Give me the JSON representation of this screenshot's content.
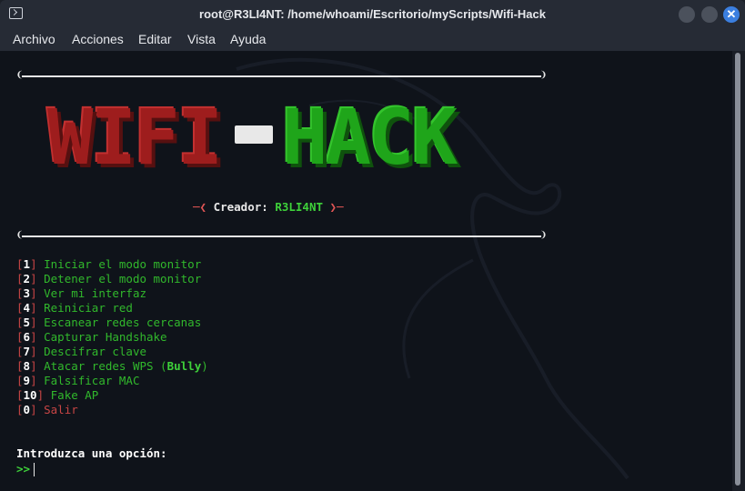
{
  "window": {
    "title": "root@R3LI4NT: /home/whoami/Escritorio/myScripts/Wifi-Hack",
    "close_glyph": "✕"
  },
  "menubar": [
    "Archivo",
    "Acciones",
    "Editar",
    "Vista",
    "Ayuda"
  ],
  "banner": {
    "logo_left": "WIFI",
    "logo_right": "HACK",
    "rule_left": "❨",
    "rule_right": "❩",
    "creator_prefix": "─❮ ",
    "creator_label": "Creador: ",
    "creator_name": "R3LI4NT",
    "creator_suffix": " ❯─"
  },
  "options": [
    {
      "num": "1",
      "label": "Iniciar el modo monitor"
    },
    {
      "num": "2",
      "label": "Detener el modo monitor"
    },
    {
      "num": "3",
      "label": "Ver mi interfaz"
    },
    {
      "num": "4",
      "label": "Reiniciar red"
    },
    {
      "num": "5",
      "label": "Escanear redes cercanas"
    },
    {
      "num": "6",
      "label": "Capturar Handshake"
    },
    {
      "num": "7",
      "label": "Descifrar clave"
    },
    {
      "num": "8",
      "label": "Atacar redes WPS (",
      "extra": "Bully",
      "tail": ")"
    },
    {
      "num": "9",
      "label": "Falsificar MAC"
    },
    {
      "num": "10",
      "label": "Fake AP"
    },
    {
      "num": "0",
      "label": "Salir"
    }
  ],
  "prompt": "Introduzca una opción:",
  "input_marker": ">>",
  "colors": {
    "red": "#c84545",
    "green": "#31b82c",
    "accent": "#3b7fe0"
  }
}
